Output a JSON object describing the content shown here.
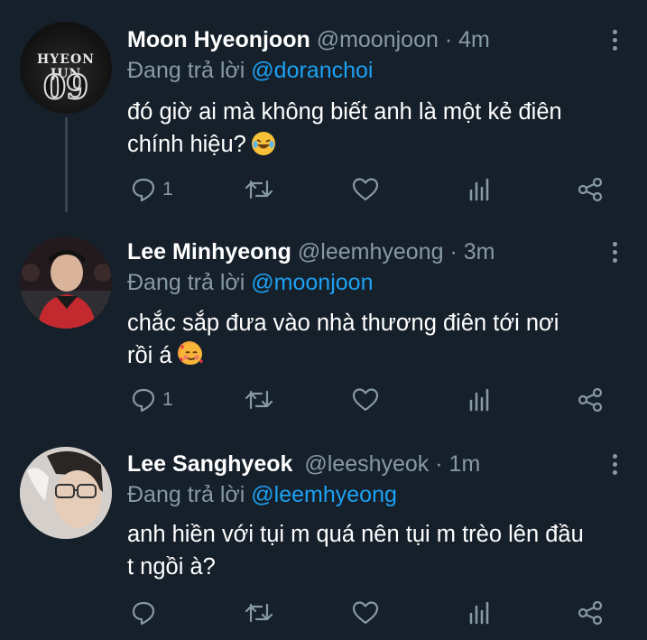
{
  "colors": {
    "background": "#15202b",
    "text": "#ffffff",
    "secondary": "#8899a6",
    "link": "#1da1f2",
    "thread_line": "#38444d"
  },
  "tweets": [
    {
      "name": "Moon Hyeonjoon",
      "handle": "@moonjoon",
      "separator": "·",
      "time": "4m",
      "reply_prefix": "Đang trả lời",
      "reply_to": "@doranchoi",
      "text_line1": "đó giờ ai mà không biết anh là một kẻ điên",
      "text_line2": "chính hiệu?",
      "emoji": "face-with-tears-of-joy",
      "reply_count": "1",
      "avatar_text_top": "HYEON JUN",
      "avatar_text_num": "09"
    },
    {
      "name": "Lee Minhyeong",
      "handle": "@leemhyeong",
      "separator": "·",
      "time": "3m",
      "reply_prefix": "Đang trả lời",
      "reply_to": "@moonjoon",
      "text_line1": "chắc sắp đưa vào nhà thương điên tới nơi",
      "text_line2": "rồi á",
      "emoji": "smiling-face-with-hearts",
      "reply_count": "1"
    },
    {
      "name": "Lee Sanghyeok",
      "handle": "@leeshyeok",
      "separator": "·",
      "time": "1m",
      "reply_prefix": "Đang trả lời",
      "reply_to": "@leemhyeong",
      "text_line1": "anh hiền với tụi m quá nên tụi m trèo lên đầu",
      "text_line2": "t ngồi à?",
      "reply_count": ""
    }
  ],
  "icons": {
    "reply": "reply-icon",
    "retweet": "retweet-icon",
    "like": "heart-icon",
    "analytics": "analytics-icon",
    "share": "share-icon",
    "more": "more-vertical-icon"
  }
}
